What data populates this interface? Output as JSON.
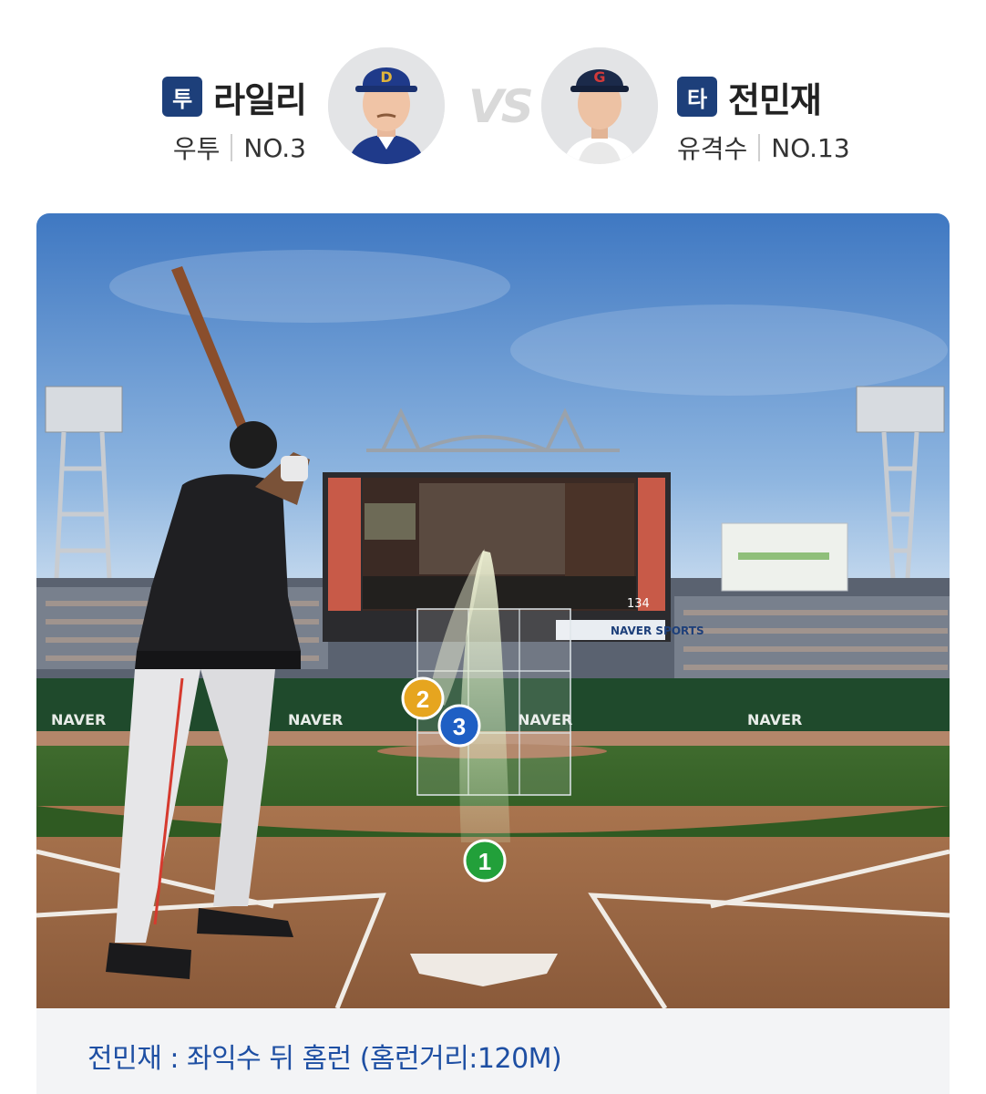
{
  "pitcher": {
    "role": "투",
    "name": "라일리",
    "throw_type": "우투",
    "number": "NO.3",
    "cap_color": "#1f3a8a"
  },
  "vs_label": "VS",
  "batter": {
    "role": "타",
    "name": "전민재",
    "position": "유격수",
    "number": "NO.13",
    "cap_color": "#1b2a4a"
  },
  "field": {
    "sponsor_board": "NAVER",
    "sports_board": "NAVER SPORTS",
    "speed_readout": "134",
    "pitches": [
      {
        "label": "1",
        "color": "#22a03a"
      },
      {
        "label": "2",
        "color": "#e6a51f"
      },
      {
        "label": "3",
        "color": "#1f5fc4"
      }
    ]
  },
  "result_text": "전민재 : 좌익수 뒤 홈런 (홈런거리:120M)"
}
